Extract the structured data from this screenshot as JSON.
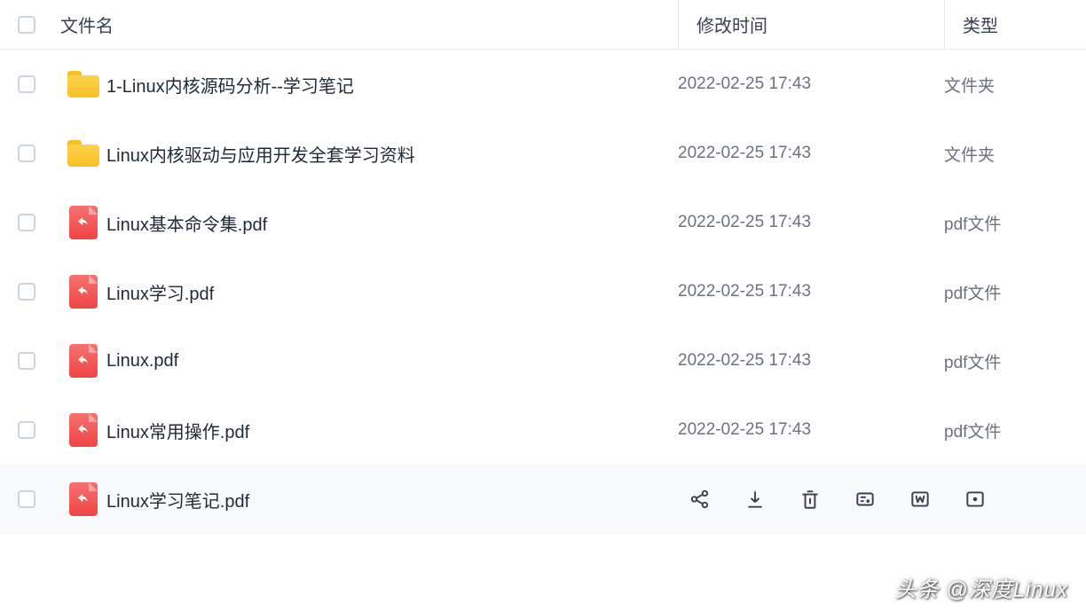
{
  "header": {
    "name": "文件名",
    "date": "修改时间",
    "type": "类型"
  },
  "rows": [
    {
      "icon": "folder",
      "name": "1-Linux内核源码分析--学习笔记",
      "date": "2022-02-25 17:43",
      "type": "文件夹",
      "hover": false
    },
    {
      "icon": "folder",
      "name": "Linux内核驱动与应用开发全套学习资料",
      "date": "2022-02-25 17:43",
      "type": "文件夹",
      "hover": false
    },
    {
      "icon": "pdf",
      "name": "Linux基本命令集.pdf",
      "date": "2022-02-25 17:43",
      "type": "pdf文件",
      "hover": false
    },
    {
      "icon": "pdf",
      "name": "Linux学习.pdf",
      "date": "2022-02-25 17:43",
      "type": "pdf文件",
      "hover": false
    },
    {
      "icon": "pdf",
      "name": "Linux.pdf",
      "date": "2022-02-25 17:43",
      "type": "pdf文件",
      "hover": false
    },
    {
      "icon": "pdf",
      "name": "Linux常用操作.pdf",
      "date": "2022-02-25 17:43",
      "type": "pdf文件",
      "hover": false
    },
    {
      "icon": "pdf",
      "name": "Linux学习笔记.pdf",
      "date": "",
      "type": "",
      "hover": true
    }
  ],
  "watermark": "头条 @深度Linux"
}
